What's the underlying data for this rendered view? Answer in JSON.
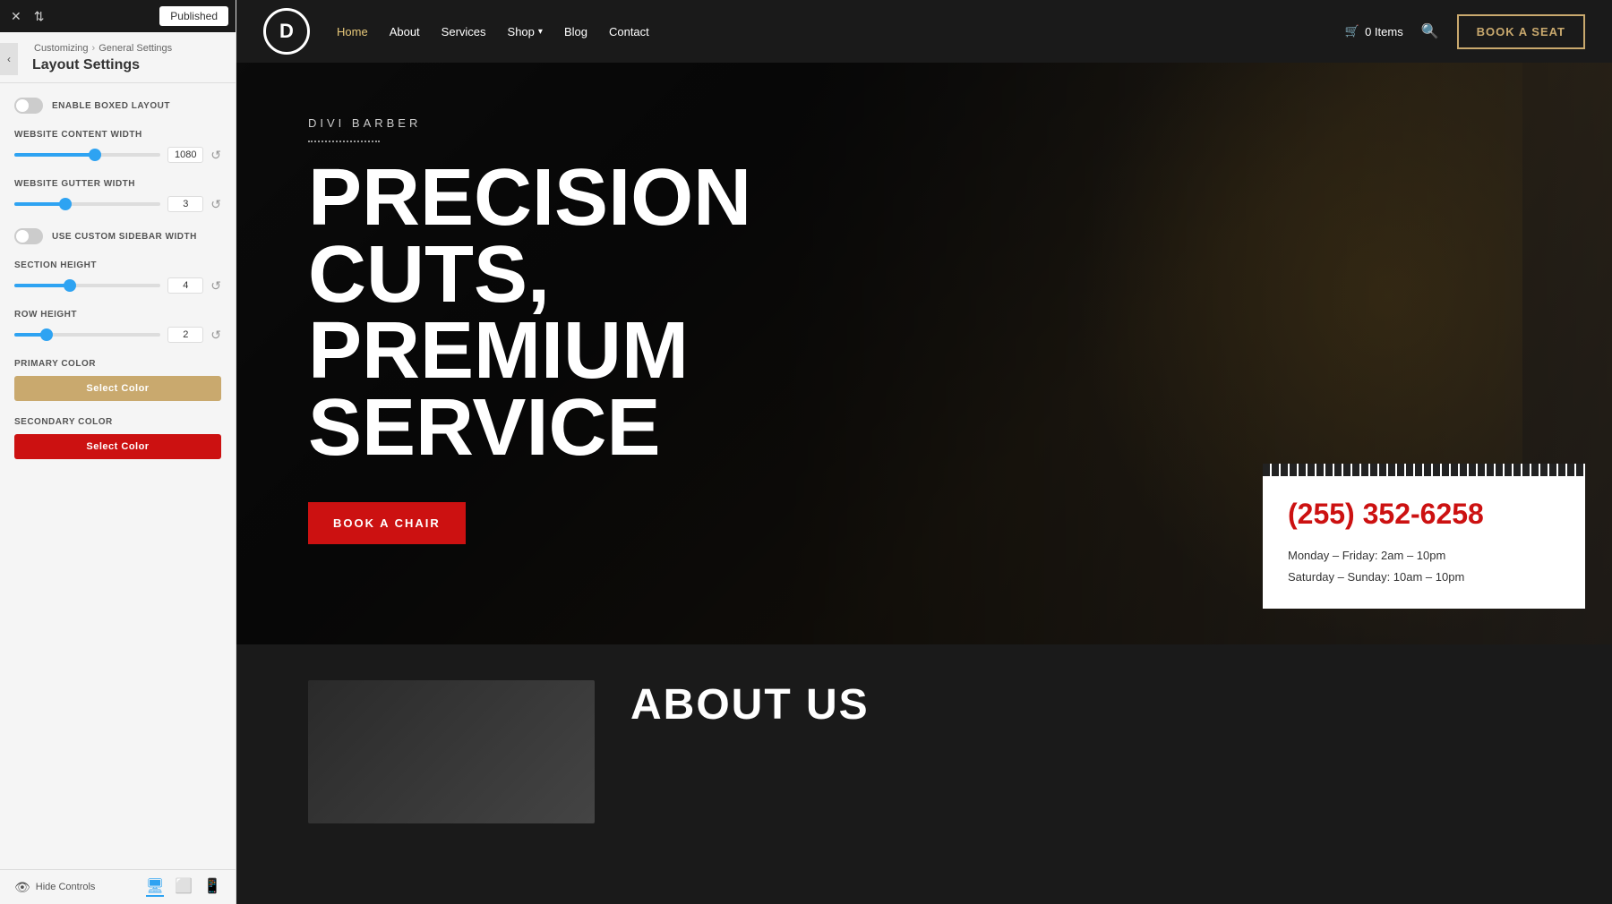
{
  "sidebar": {
    "top_bar": {
      "close_icon": "✕",
      "sort_icon": "⇅",
      "published_label": "Published"
    },
    "breadcrumb": {
      "parent": "Customizing",
      "separator": "›",
      "child": "General Settings"
    },
    "back_icon": "‹",
    "layout_title": "Layout Settings",
    "settings": {
      "enable_boxed_layout": {
        "label": "ENABLE BOXED LAYOUT",
        "toggled": false
      },
      "website_content_width": {
        "label": "WEBSITE CONTENT WIDTH",
        "value": "1080",
        "percent": 55
      },
      "website_gutter_width": {
        "label": "WEBSITE GUTTER WIDTH",
        "value": "3",
        "percent": 35
      },
      "use_custom_sidebar_width": {
        "label": "USE CUSTOM SIDEBAR WIDTH",
        "toggled": false
      },
      "section_height": {
        "label": "SECTION HEIGHT",
        "value": "4",
        "percent": 38
      },
      "row_height": {
        "label": "ROW HEIGHT",
        "value": "2",
        "percent": 22
      },
      "primary_color": {
        "label": "PRIMARY COLOR",
        "button_label": "Select Color",
        "color": "#c9a96e"
      },
      "secondary_color": {
        "label": "SECONDARY COLOR",
        "button_label": "Select Color",
        "color": "#cc1111"
      }
    },
    "footer": {
      "hide_controls_label": "Hide Controls",
      "eye_icon": "👁",
      "desktop_icon": "🖥",
      "tablet_icon": "📱",
      "mobile_icon": "📱"
    }
  },
  "navbar": {
    "logo_letter": "D",
    "links": [
      {
        "label": "Home",
        "active": true
      },
      {
        "label": "About",
        "active": false
      },
      {
        "label": "Services",
        "active": false
      },
      {
        "label": "Shop",
        "active": false,
        "has_dropdown": true
      },
      {
        "label": "Blog",
        "active": false
      },
      {
        "label": "Contact",
        "active": false
      }
    ],
    "cart_label": "0 Items",
    "search_icon": "🔍",
    "book_button": "BOOK A SEAT"
  },
  "hero": {
    "subtitle": "DIVI BARBER",
    "title_line1": "PRECISION CUTS,",
    "title_line2": "PREMIUM SERVICE",
    "cta_button": "BOOK A CHAIR"
  },
  "contact_box": {
    "phone": "(255) 352-6258",
    "hours_line1": "Monday – Friday: 2am – 10pm",
    "hours_line2": "Saturday – Sunday: 10am – 10pm"
  },
  "about": {
    "title": "ABOUT US"
  }
}
